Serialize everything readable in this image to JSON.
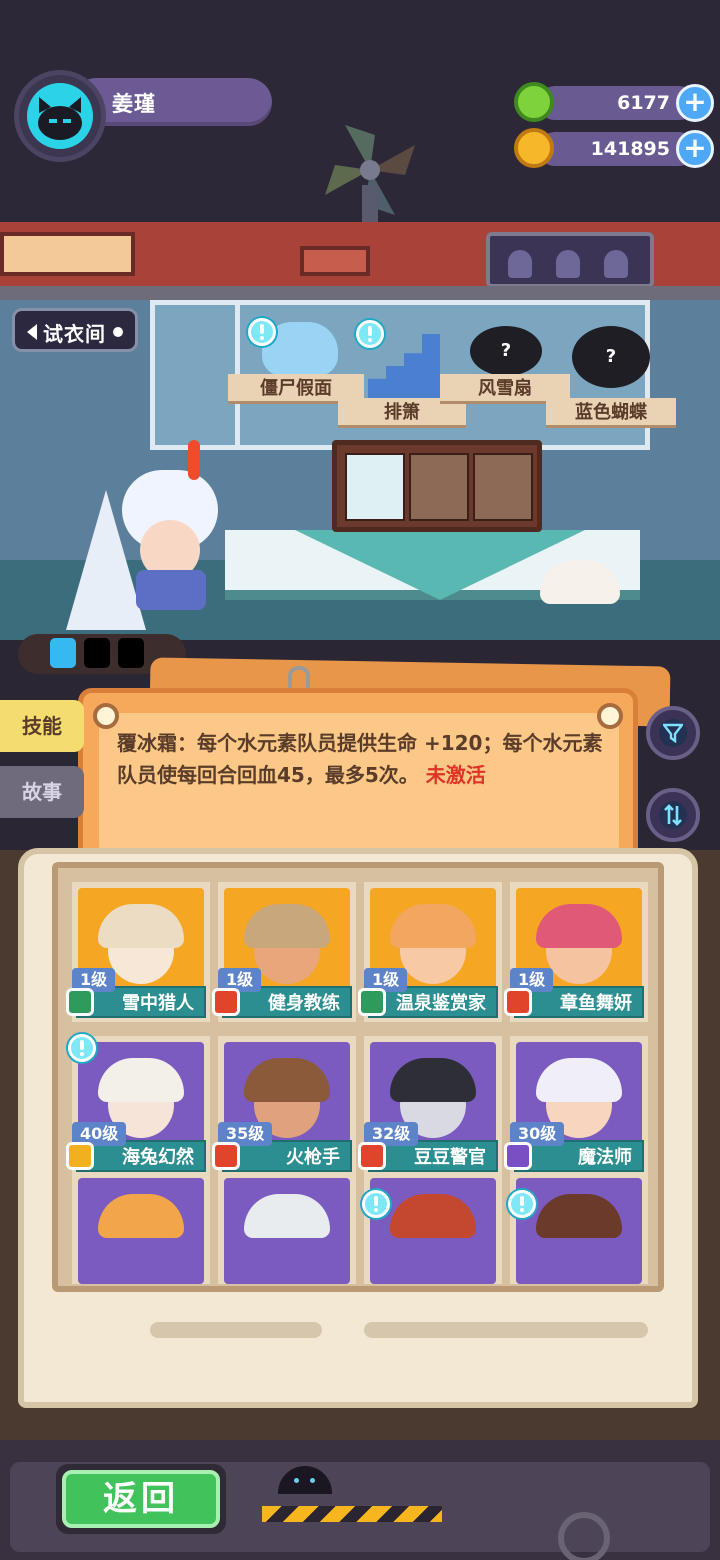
{
  "player": {
    "name": "姜瑾"
  },
  "currencies": [
    {
      "icon": "green-gem-icon",
      "value": "6177"
    },
    {
      "icon": "gold-coin-icon",
      "value": "141895"
    }
  ],
  "scene": {
    "fitting_room_label": "试衣间",
    "items": [
      {
        "label": "僵尸假面"
      },
      {
        "label": "排箫"
      },
      {
        "label": "风雪扇",
        "locked_mark": "?"
      },
      {
        "label": "蓝色蝴蝶",
        "locked_mark": "?"
      }
    ]
  },
  "tabs": [
    {
      "label": "技能",
      "active": true
    },
    {
      "label": "故事",
      "active": false
    }
  ],
  "skill": {
    "description": "覆冰霜：每个水元素队员提供生命 +120；每个水元素队员使每回合回血45，最多5次。",
    "status": "未激活"
  },
  "cards": [
    {
      "level": "1级",
      "name": "雪中猎人",
      "rank_color": "#2e9b5c"
    },
    {
      "level": "1级",
      "name": "健身教练",
      "rank_color": "#e0452c"
    },
    {
      "level": "1级",
      "name": "温泉鉴赏家",
      "rank_color": "#2e9b5c"
    },
    {
      "level": "1级",
      "name": "章鱼舞妍",
      "rank_color": "#e0452c"
    },
    {
      "level": "40级",
      "name": "海兔幻然",
      "rank_color": "#f0b020"
    },
    {
      "level": "35级",
      "name": "火枪手",
      "rank_color": "#e0452c"
    },
    {
      "level": "32级",
      "name": "豆豆警官",
      "rank_color": "#e0452c"
    },
    {
      "level": "30级",
      "name": "魔法师",
      "rank_color": "#7a4fc4"
    }
  ],
  "bottom": {
    "back_label": "返回"
  },
  "colors": {
    "accent_green": "#42c25a",
    "status_red": "#e03327",
    "card_teal": "#2b8e90",
    "level_blue": "#5d83c9"
  }
}
